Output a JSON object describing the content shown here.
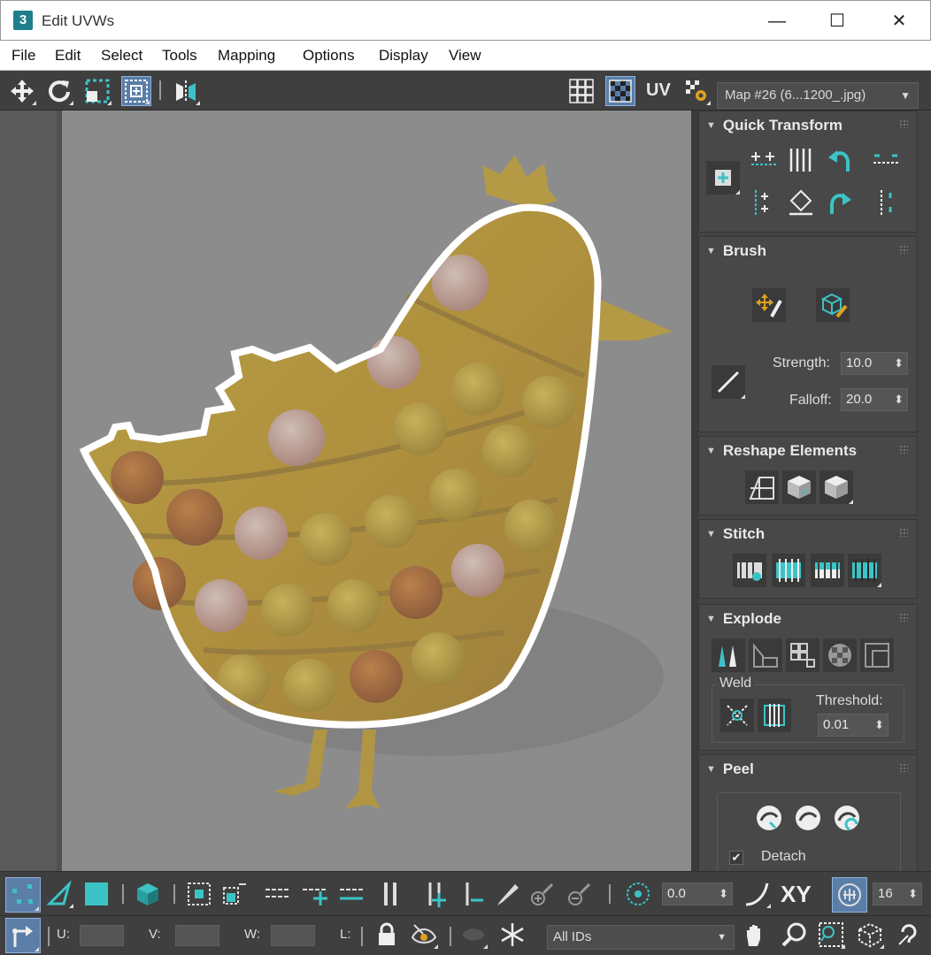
{
  "window": {
    "title": "Edit UVWs",
    "app_icon_text": "3",
    "minimize": "—",
    "maximize": "☐",
    "close": "✕"
  },
  "menu": [
    "File",
    "Edit",
    "Select",
    "Tools",
    "Mapping",
    "Options",
    "Display",
    "View"
  ],
  "toolbar": {
    "uv_label": "UV",
    "map_select": "Map #26 (6...1200_.jpg)"
  },
  "quick_transform": {
    "title": "Quick Transform"
  },
  "brush": {
    "title": "Brush",
    "strength_label": "Strength:",
    "strength_value": "10.0",
    "falloff_label": "Falloff:",
    "falloff_value": "20.0"
  },
  "reshape": {
    "title": "Reshape Elements"
  },
  "stitch": {
    "title": "Stitch"
  },
  "explode": {
    "title": "Explode",
    "weld_label": "Weld",
    "threshold_label": "Threshold:",
    "threshold_value": "0.01"
  },
  "peel": {
    "title": "Peel",
    "detach_label": "Detach",
    "detach_checked": "✔"
  },
  "bottom1": {
    "spin_value": "0.0",
    "xy_label": "XY",
    "grid_value": "16"
  },
  "bottom2": {
    "u_label": "U:",
    "v_label": "V:",
    "w_label": "W:",
    "l_label": "L:",
    "ids_select": "All IDs"
  },
  "colors": {
    "accent": "#3cc3c6",
    "active": "#5b7ea8",
    "uv_outline": "#ffffff"
  }
}
